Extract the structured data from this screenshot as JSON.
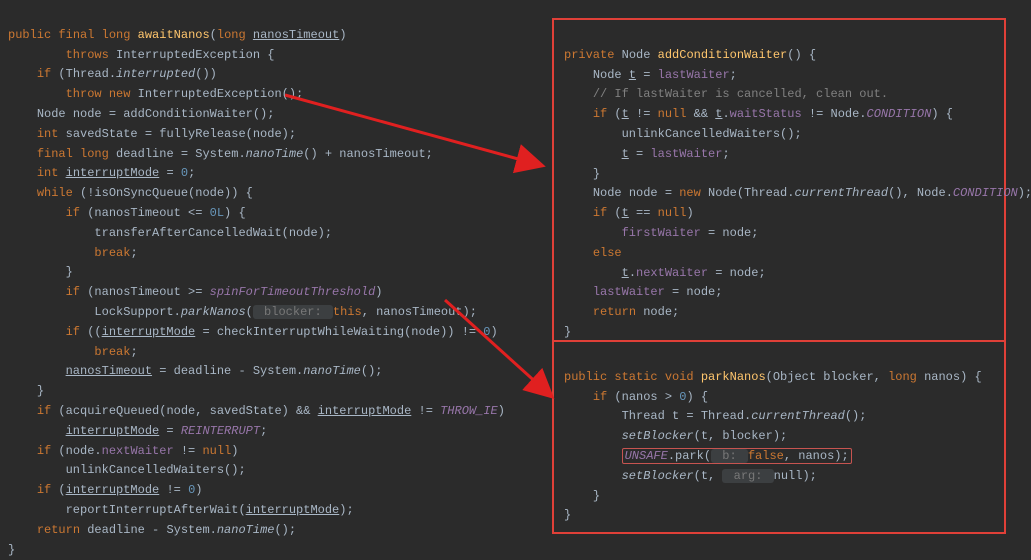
{
  "left": {
    "l1_kw_public": "public",
    "l1_kw_final": "final",
    "l1_kw_long": "long",
    "l1_method": "awaitNanos",
    "l1_ptype": "long",
    "l1_pname": "nanosTimeout",
    "l2_throws": "throws",
    "l2_ex": "InterruptedException {",
    "l3_if": "if",
    "l3_thread": " (Thread.",
    "l3_interrupted": "interrupted",
    "l3_end": "())",
    "l4_throw": "throw new",
    "l4_ex": " InterruptedException();",
    "l5_node": "Node node = addConditionWaiter();",
    "l6_a": "int",
    "l6_b": " savedState = fullyRelease(node);",
    "l7_a": "final long",
    "l7_b": " deadline = System.",
    "l7_c": "nanoTime",
    "l7_d": "() + nanosTimeout;",
    "l8_a": "int ",
    "l8_b": "interruptMode",
    "l8_c": " = ",
    "l8_d": "0",
    "l8_e": ";",
    "l9_a": "while",
    "l9_b": " (!isOnSyncQueue(node)) {",
    "l10_a": "if",
    "l10_b": " (nanosTimeout <= ",
    "l10_c": "0L",
    "l10_d": ") {",
    "l11": "transferAfterCancelledWait(node);",
    "l12": "break",
    "l12b": ";",
    "l13": "}",
    "l14_a": "if",
    "l14_b": " (nanosTimeout >= ",
    "l14_c": "spinForTimeoutThreshold",
    "l14_d": ")",
    "l15_a": "LockSupport.",
    "l15_b": "parkNanos",
    "l15_c": "(",
    "l15_hint": " blocker: ",
    "l15_d": "this",
    "l15_e": ", nanosTimeout);",
    "l16_a": "if",
    "l16_b": " ((",
    "l16_c": "interruptMode",
    "l16_d": " = checkInterruptWhileWaiting(node)) != ",
    "l16_e": "0",
    "l16_f": ")",
    "l17": "break",
    "l17b": ";",
    "l18_a": "nanosTimeout",
    "l18_b": " = deadline - System.",
    "l18_c": "nanoTime",
    "l18_d": "();",
    "l19": "}",
    "l20_a": "if",
    "l20_b": " (acquireQueued(node, savedState) && ",
    "l20_c": "interruptMode",
    "l20_d": " != ",
    "l20_e": "THROW_IE",
    "l20_f": ")",
    "l21_a": "interruptMode",
    "l21_b": " = ",
    "l21_c": "REINTERRUPT",
    "l21_d": ";",
    "l22_a": "if",
    "l22_b": " (node.",
    "l22_c": "nextWaiter",
    "l22_d": " != ",
    "l22_e": "null",
    "l22_f": ")",
    "l23": "unlinkCancelledWaiters();",
    "l24_a": "if",
    "l24_b": " (",
    "l24_c": "interruptMode",
    "l24_d": " != ",
    "l24_e": "0",
    "l24_f": ")",
    "l25_a": "reportInterruptAfterWait(",
    "l25_b": "interruptMode",
    "l25_c": ");",
    "l26_a": "return",
    "l26_b": " deadline - System.",
    "l26_c": "nanoTime",
    "l26_d": "();",
    "l27": "}"
  },
  "r1": {
    "l1_a": "private",
    "l1_b": " Node ",
    "l1_c": "addConditionWaiter",
    "l1_d": "() {",
    "l2_a": "Node ",
    "l2_b": "t",
    "l2_c": " = ",
    "l2_d": "lastWaiter",
    "l2_e": ";",
    "l3": "// If lastWaiter is cancelled, clean out.",
    "l4_a": "if",
    "l4_b": " (",
    "l4_c": "t",
    "l4_d": " != ",
    "l4_e": "null",
    "l4_f": " && ",
    "l4_g": "t",
    "l4_h": ".",
    "l4_i": "waitStatus",
    "l4_j": " != Node.",
    "l4_k": "CONDITION",
    "l4_l": ") {",
    "l5": "unlinkCancelledWaiters();",
    "l6_a": "t",
    "l6_b": " = ",
    "l6_c": "lastWaiter",
    "l6_d": ";",
    "l7": "}",
    "l8_a": "Node node = ",
    "l8_b": "new",
    "l8_c": " Node(Thread.",
    "l8_d": "currentThread",
    "l8_e": "(), Node.",
    "l8_f": "CONDITION",
    "l8_g": ");",
    "l9_a": "if",
    "l9_b": " (",
    "l9_c": "t",
    "l9_d": " == ",
    "l9_e": "null",
    "l9_f": ")",
    "l10_a": "firstWaiter",
    "l10_b": " = node;",
    "l11_a": "else",
    "l12_a": "t",
    "l12_b": ".",
    "l12_c": "nextWaiter",
    "l12_d": " = node;",
    "l13_a": "lastWaiter",
    "l13_b": " = node;",
    "l14_a": "return",
    "l14_b": " node;",
    "l15": "}"
  },
  "r2": {
    "l1_a": "public static void",
    "l1_b": " ",
    "l1_c": "parkNanos",
    "l1_d": "(Object blocker, ",
    "l1_e": "long",
    "l1_f": " nanos) {",
    "l2_a": "if",
    "l2_b": " (nanos > ",
    "l2_c": "0",
    "l2_d": ") {",
    "l3_a": "Thread t = Thread.",
    "l3_b": "currentThread",
    "l3_c": "();",
    "l4_a": "setBlocker",
    "l4_b": "(t, blocker);",
    "l5_a": "UNSAFE",
    "l5_b": ".park(",
    "l5_hint1": " b: ",
    "l5_c": "false",
    "l5_d": ", nanos);",
    "l6_a": "setBlocker",
    "l6_b": "(t, ",
    "l6_hint": " arg: ",
    "l6_c": "null);",
    "l7": "}",
    "l8": "}"
  }
}
